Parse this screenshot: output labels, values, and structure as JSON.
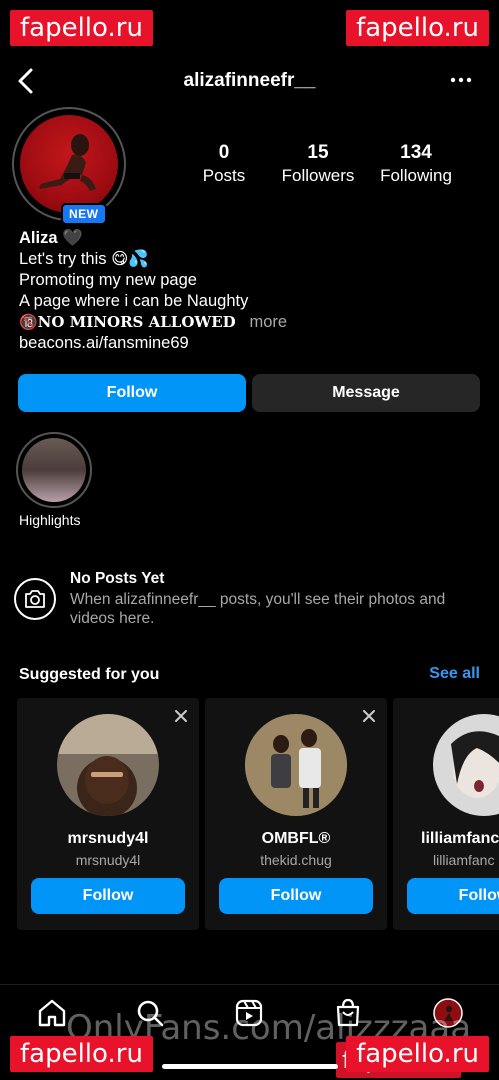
{
  "watermarks": {
    "fapello": "fapello.ru",
    "onlyfans": "OnlyFans.com/alizzzaaa"
  },
  "header": {
    "username": "alizafinneefr__",
    "back_icon": "chevron-left-icon",
    "more_icon": "more-horizontal-icon"
  },
  "profile": {
    "new_badge": "NEW",
    "stats": [
      {
        "value": "0",
        "label": "Posts"
      },
      {
        "value": "15",
        "label": "Followers"
      },
      {
        "value": "134",
        "label": "Following"
      }
    ],
    "name": "Aliza",
    "name_emoji": "🖤",
    "bio_lines": [
      "Let's try this 😋💦",
      "Promoting my new page",
      "A page where i can be Naughty"
    ],
    "minors_line": "🔞NO MINORS ALLOWED",
    "more": "more",
    "link": "beacons.ai/fansmine69"
  },
  "actions": {
    "follow": "Follow",
    "message": "Message"
  },
  "highlights": {
    "label": "Highlights"
  },
  "no_posts": {
    "title": "No Posts Yet",
    "text": "When alizafinneefr__ posts, you'll see their photos and videos here."
  },
  "suggested": {
    "title": "Suggested for you",
    "see_all": "See all",
    "cards": [
      {
        "name": "mrsnudy4l",
        "username": "mrsnudy4l",
        "follow": "Follow"
      },
      {
        "name": "OMBFL®",
        "username": "thekid.chug",
        "follow": "Follow"
      },
      {
        "name": "lilliamfanc",
        "username": "lilliamfanc",
        "follow": "Follow"
      }
    ]
  },
  "tabbar": {
    "icons": [
      "home-icon",
      "search-icon",
      "reels-icon",
      "shop-icon",
      "profile-icon"
    ]
  },
  "colors": {
    "accent": "#0095f6",
    "link": "#3897f0",
    "badge": "#1877f2",
    "watermark": "#e8132b"
  }
}
